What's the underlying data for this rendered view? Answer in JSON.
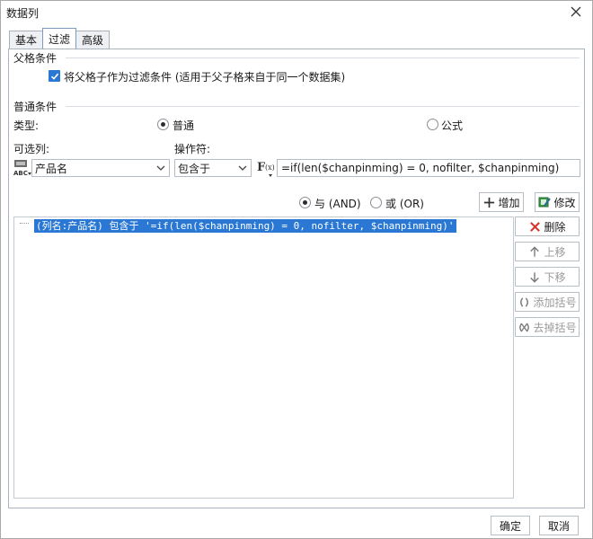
{
  "window": {
    "title": "数据列"
  },
  "tabs": [
    {
      "label": "基本"
    },
    {
      "label": "过滤"
    },
    {
      "label": "高级"
    }
  ],
  "parent_condition": {
    "section_title": "父格条件",
    "checkbox_label": "将父格子作为过滤条件 (适用于父子格来自于同一个数据集)",
    "checked": true
  },
  "common_condition": {
    "section_title": "普通条件",
    "type_label": "类型:",
    "type_options": [
      {
        "label": "普通",
        "selected": true
      },
      {
        "label": "公式",
        "selected": false
      }
    ],
    "column_label": "可选列:",
    "operator_label": "操作符:",
    "column_value": "产品名",
    "operator_value": "包含于",
    "formula_value": "=if(len($chanpinming) = 0, nofilter, $chanpinming)",
    "logic_options": [
      {
        "label": "与 (AND)",
        "selected": true
      },
      {
        "label": "或 (OR)",
        "selected": false
      }
    ],
    "add_button": "增加",
    "modify_button": "修改"
  },
  "conditions_list": [
    "(列名:产品名) 包含于 '=if(len($chanpinming) = 0, nofilter, $chanpinming)'"
  ],
  "side_buttons": {
    "delete": "删除",
    "move_up": "上移",
    "move_down": "下移",
    "add_bracket": "添加括号",
    "remove_bracket": "去掉括号"
  },
  "footer": {
    "ok": "确定",
    "cancel": "取消"
  },
  "colors": {
    "accent": "#2b78d4",
    "delete_red": "#d9312b",
    "add_green": "#2a9d3a"
  }
}
